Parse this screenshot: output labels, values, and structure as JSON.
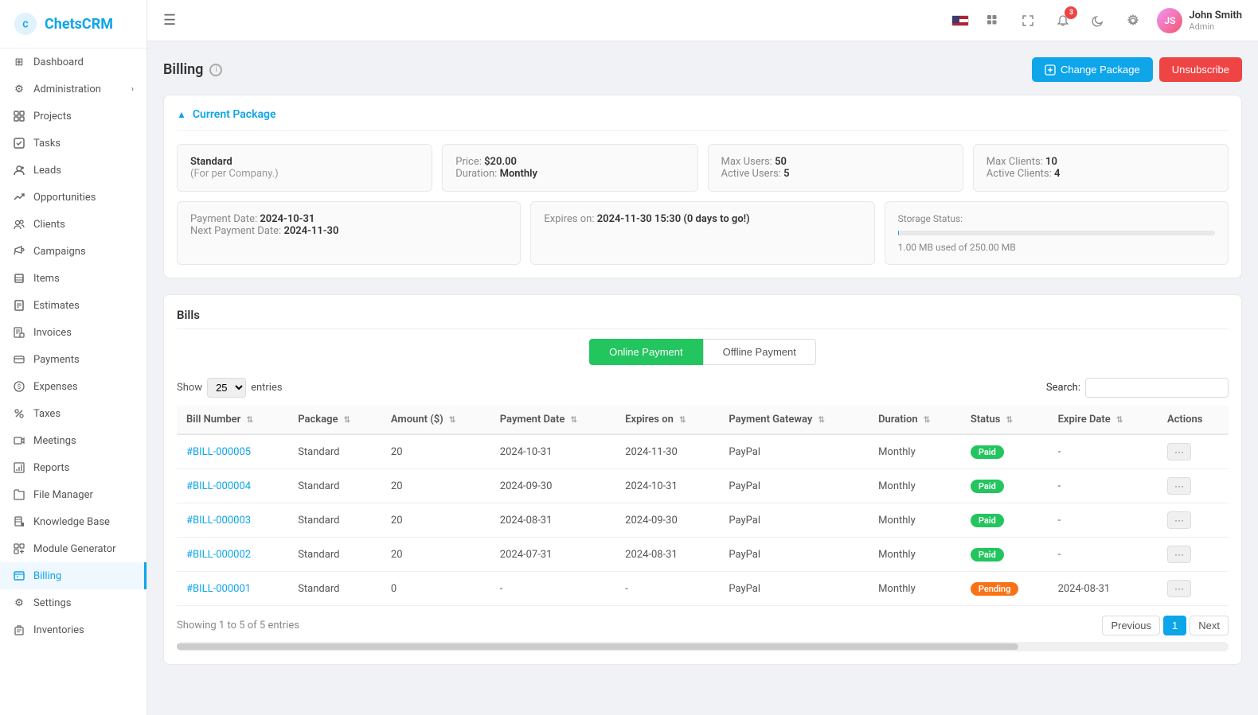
{
  "app": {
    "name": "ChetsCRM",
    "logo_text": "ChetsCRM"
  },
  "sidebar": {
    "items": [
      {
        "id": "dashboard",
        "label": "Dashboard",
        "icon": "grid-icon",
        "active": false
      },
      {
        "id": "administration",
        "label": "Administration",
        "icon": "settings-icon",
        "active": false,
        "has_arrow": true
      },
      {
        "id": "projects",
        "label": "Projects",
        "icon": "folder-icon",
        "active": false
      },
      {
        "id": "tasks",
        "label": "Tasks",
        "icon": "check-square-icon",
        "active": false
      },
      {
        "id": "leads",
        "label": "Leads",
        "icon": "user-plus-icon",
        "active": false
      },
      {
        "id": "opportunities",
        "label": "Opportunities",
        "icon": "trending-icon",
        "active": false
      },
      {
        "id": "clients",
        "label": "Clients",
        "icon": "users-icon",
        "active": false
      },
      {
        "id": "campaigns",
        "label": "Campaigns",
        "icon": "megaphone-icon",
        "active": false
      },
      {
        "id": "items",
        "label": "Items",
        "icon": "box-icon",
        "active": false
      },
      {
        "id": "estimates",
        "label": "Estimates",
        "icon": "file-text-icon",
        "active": false
      },
      {
        "id": "invoices",
        "label": "Invoices",
        "icon": "file-invoice-icon",
        "active": false
      },
      {
        "id": "payments",
        "label": "Payments",
        "icon": "credit-card-icon",
        "active": false
      },
      {
        "id": "expenses",
        "label": "Expenses",
        "icon": "dollar-icon",
        "active": false
      },
      {
        "id": "taxes",
        "label": "Taxes",
        "icon": "percent-icon",
        "active": false
      },
      {
        "id": "meetings",
        "label": "Meetings",
        "icon": "video-icon",
        "active": false
      },
      {
        "id": "reports",
        "label": "Reports",
        "icon": "bar-chart-icon",
        "active": false
      },
      {
        "id": "file-manager",
        "label": "File Manager",
        "icon": "folder2-icon",
        "active": false
      },
      {
        "id": "knowledge-base",
        "label": "Knowledge Base",
        "icon": "book-icon",
        "active": false
      },
      {
        "id": "module-generator",
        "label": "Module Generator",
        "icon": "cpu-icon",
        "active": false
      },
      {
        "id": "billing",
        "label": "Billing",
        "icon": "receipt-icon",
        "active": true
      },
      {
        "id": "settings",
        "label": "Settings",
        "icon": "gear-icon",
        "active": false
      },
      {
        "id": "inventories",
        "label": "Inventories",
        "icon": "archive-icon",
        "active": false
      }
    ]
  },
  "header": {
    "hamburger_label": "☰",
    "notification_count": "3",
    "user": {
      "name": "John Smith",
      "role": "Admin",
      "initials": "JS"
    }
  },
  "page": {
    "title": "Billing",
    "change_package_label": "Change Package",
    "unsubscribe_label": "Unsubscribe"
  },
  "current_package": {
    "section_title": "Current Package",
    "name": "Standard",
    "subtitle": "(For per Company.)",
    "price_label": "Price:",
    "price_value": "$20.00",
    "duration_label": "Duration:",
    "duration_value": "Monthly",
    "max_users_label": "Max Users:",
    "max_users_value": "50",
    "active_users_label": "Active Users:",
    "active_users_value": "5",
    "max_clients_label": "Max Clients:",
    "max_clients_value": "10",
    "active_clients_label": "Active Clients:",
    "active_clients_value": "4",
    "payment_date_label": "Payment Date:",
    "payment_date_value": "2024-10-31",
    "next_payment_label": "Next Payment Date:",
    "next_payment_value": "2024-11-30",
    "expires_on_label": "Expires on:",
    "expires_on_value": "2024-11-30 15:30 (0 days to go!)",
    "storage_status_label": "Storage Status:",
    "storage_used": "1.00 MB used of 250.00 MB",
    "storage_percent": 0.4
  },
  "bills": {
    "section_title": "Bills",
    "online_payment_label": "Online Payment",
    "offline_payment_label": "Offline Payment",
    "show_label": "Show",
    "entries_label": "entries",
    "show_value": "25",
    "search_label": "Search:",
    "search_placeholder": "",
    "columns": [
      "Bill Number",
      "Package",
      "Amount ($)",
      "Payment Date",
      "Expires on",
      "Payment Gateway",
      "Duration",
      "Status",
      "Expire Date",
      "Actions"
    ],
    "rows": [
      {
        "bill_number": "#BILL-000005",
        "package": "Standard",
        "amount": "20",
        "payment_date": "2024-10-31",
        "expires_on": "2024-11-30",
        "gateway": "PayPal",
        "duration": "Monthly",
        "status": "Paid",
        "expire_date": "-"
      },
      {
        "bill_number": "#BILL-000004",
        "package": "Standard",
        "amount": "20",
        "payment_date": "2024-09-30",
        "expires_on": "2024-10-31",
        "gateway": "PayPal",
        "duration": "Monthly",
        "status": "Paid",
        "expire_date": "-"
      },
      {
        "bill_number": "#BILL-000003",
        "package": "Standard",
        "amount": "20",
        "payment_date": "2024-08-31",
        "expires_on": "2024-09-30",
        "gateway": "PayPal",
        "duration": "Monthly",
        "status": "Paid",
        "expire_date": "-"
      },
      {
        "bill_number": "#BILL-000002",
        "package": "Standard",
        "amount": "20",
        "payment_date": "2024-07-31",
        "expires_on": "2024-08-31",
        "gateway": "PayPal",
        "duration": "Monthly",
        "status": "Paid",
        "expire_date": "-"
      },
      {
        "bill_number": "#BILL-000001",
        "package": "Standard",
        "amount": "0",
        "payment_date": "-",
        "expires_on": "-",
        "gateway": "PayPal",
        "duration": "Monthly",
        "status": "Pending",
        "expire_date": "2024-08-31"
      }
    ],
    "footer_text": "Showing 1 to 5 of 5 entries",
    "prev_label": "Previous",
    "next_label": "Next",
    "current_page": "1"
  },
  "icons": {
    "grid": "⊞",
    "settings": "⚙",
    "folder": "📁",
    "check": "✓",
    "user": "👤",
    "users": "👥",
    "trending": "📈",
    "megaphone": "📣",
    "box": "📦",
    "file": "📄",
    "credit_card": "💳",
    "dollar": "💰",
    "percent": "%",
    "video": "🎥",
    "bar_chart": "📊",
    "book": "📖",
    "cpu": "🖥",
    "receipt": "🧾",
    "gear": "⚙",
    "archive": "🗂"
  }
}
